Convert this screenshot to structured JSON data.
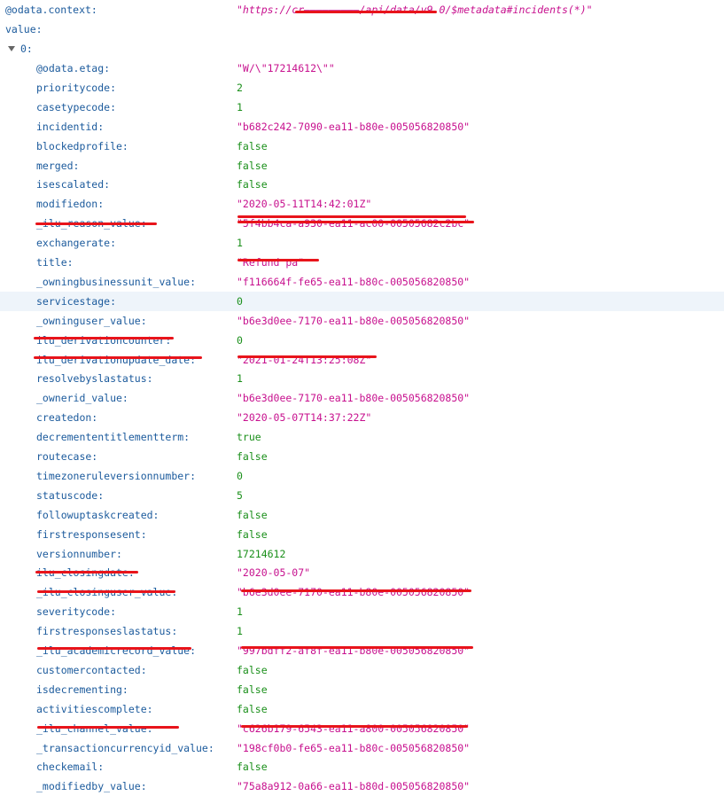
{
  "root": {
    "context_key": "@odata.context:",
    "context_value": "\"https://cr—————————/api/data/v9.0/$metadata#incidents(*)\"",
    "value_key": "value:",
    "index_key": "0:"
  },
  "properties": [
    {
      "key": "@odata.etag:",
      "value": "\"W/\\\"17214612\\\"\"",
      "type": "str"
    },
    {
      "key": "prioritycode:",
      "value": "2",
      "type": "num"
    },
    {
      "key": "casetypecode:",
      "value": "1",
      "type": "num"
    },
    {
      "key": "incidentid:",
      "value": "\"b682c242-7090-ea11-b80e-005056820850\"",
      "type": "str"
    },
    {
      "key": "blockedprofile:",
      "value": "false",
      "type": "bool"
    },
    {
      "key": "merged:",
      "value": "false",
      "type": "bool"
    },
    {
      "key": "isescalated:",
      "value": "false",
      "type": "bool"
    },
    {
      "key": "modifiedon:",
      "value": "\"2020-05-11T14:42:01Z\"",
      "type": "str"
    },
    {
      "key": "_ilu_reason_value:",
      "value": "\"5f4bb4ca-a930-ea11-ac00-00505682c2bc\"",
      "type": "str"
    },
    {
      "key": "exchangerate:",
      "value": "1",
      "type": "num"
    },
    {
      "key": "title:",
      "value": "\"Refund pa\"",
      "type": "str"
    },
    {
      "key": "_owningbusinessunit_value:",
      "value": "\"f116664f-fe65-ea11-b80c-005056820850\"",
      "type": "str"
    },
    {
      "key": "servicestage:",
      "value": "0",
      "type": "num"
    },
    {
      "key": "_owninguser_value:",
      "value": "\"b6e3d0ee-7170-ea11-b80e-005056820850\"",
      "type": "str"
    },
    {
      "key": "ilu_derivationcounter:",
      "value": "0",
      "type": "num"
    },
    {
      "key": "ilu_derivationupdate_date:",
      "value": "\"2021-01-24T13:25:08Z\"",
      "type": "str"
    },
    {
      "key": "resolvebyslastatus:",
      "value": "1",
      "type": "num"
    },
    {
      "key": "_ownerid_value:",
      "value": "\"b6e3d0ee-7170-ea11-b80e-005056820850\"",
      "type": "str"
    },
    {
      "key": "createdon:",
      "value": "\"2020-05-07T14:37:22Z\"",
      "type": "str"
    },
    {
      "key": "decremententitlementterm:",
      "value": "true",
      "type": "bool"
    },
    {
      "key": "routecase:",
      "value": "false",
      "type": "bool"
    },
    {
      "key": "timezoneruleversionnumber:",
      "value": "0",
      "type": "num"
    },
    {
      "key": "statuscode:",
      "value": "5",
      "type": "num"
    },
    {
      "key": "followuptaskcreated:",
      "value": "false",
      "type": "bool"
    },
    {
      "key": "firstresponsesent:",
      "value": "false",
      "type": "bool"
    },
    {
      "key": "versionnumber:",
      "value": "17214612",
      "type": "num"
    },
    {
      "key": "ilu_closingdate:",
      "value": "\"2020-05-07\"",
      "type": "str"
    },
    {
      "key": "_ilu_closinguser_value:",
      "value": "\"b6e3d0ee-7170-ea11-b80e-005056820850\"",
      "type": "str"
    },
    {
      "key": "severitycode:",
      "value": "1",
      "type": "num"
    },
    {
      "key": "firstresponseslastatus:",
      "value": "1",
      "type": "num"
    },
    {
      "key": "_ilu_academicrecord_value:",
      "value": "\"997bdff2-af8f-ea11-b80e-005056820850\"",
      "type": "str"
    },
    {
      "key": "customercontacted:",
      "value": "false",
      "type": "bool"
    },
    {
      "key": "isdecrementing:",
      "value": "false",
      "type": "bool"
    },
    {
      "key": "activitiescomplete:",
      "value": "false",
      "type": "bool"
    },
    {
      "key": "_ilu_channel_value:",
      "value": "\"c626b179-6543-ea11-a800-005056820850\"",
      "type": "str"
    },
    {
      "key": "_transactioncurrencyid_value:",
      "value": "\"198cf0b0-fe65-ea11-b80c-005056820850\"",
      "type": "str"
    },
    {
      "key": "checkemail:",
      "value": "false",
      "type": "bool"
    },
    {
      "key": "_modifiedby_value:",
      "value": "\"75a8a912-0a66-ea11-b80d-005056820850\"",
      "type": "str"
    }
  ],
  "colors": {
    "key": "#1b5a9c",
    "string": "#c7108e",
    "number": "#1a8f1a",
    "redaction": "#e8141b",
    "highlight_row": "#eef4fa"
  }
}
